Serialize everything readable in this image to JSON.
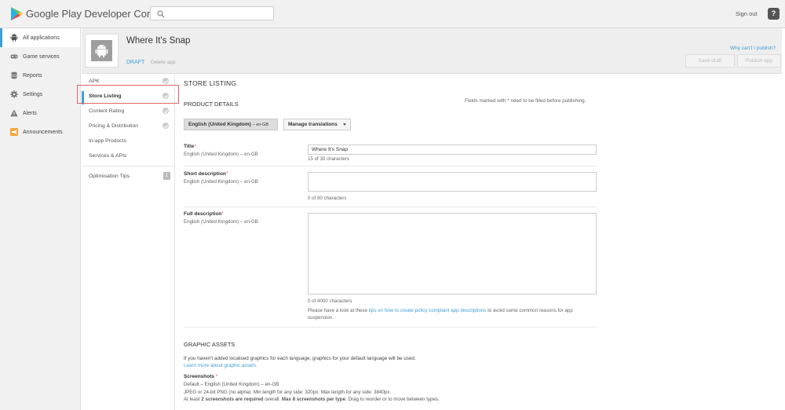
{
  "header": {
    "brand_google": "Google Play",
    "brand_console": "Developer Console",
    "search_placeholder": "",
    "sign_out": "Sign out",
    "help_glyph": "?"
  },
  "leftnav": {
    "items": [
      {
        "label": "All applications",
        "icon": "android-icon",
        "active": true
      },
      {
        "label": "Game services",
        "icon": "gamepad-icon"
      },
      {
        "label": "Reports",
        "icon": "database-icon"
      },
      {
        "label": "Settings",
        "icon": "gear-icon"
      },
      {
        "label": "Alerts",
        "icon": "warning-icon"
      },
      {
        "label": "Announcements",
        "icon": "megaphone-icon"
      }
    ]
  },
  "app": {
    "title": "Where It's Snap",
    "status": "DRAFT",
    "delete": "Delete app",
    "why_cant_publish": "Why can't I publish?",
    "save_draft": "Save draft",
    "publish": "Publish app"
  },
  "subnav": {
    "items": [
      {
        "label": "APK",
        "checked": true
      },
      {
        "label": "Store Listing",
        "checked": true,
        "selected": true
      },
      {
        "label": "Content Rating",
        "checked": true
      },
      {
        "label": "Pricing & Distribution",
        "checked": true
      },
      {
        "label": "In-app Products",
        "checked": false
      },
      {
        "label": "Services & APIs",
        "checked": false
      }
    ],
    "optimisation": {
      "label": "Optimisation Tips",
      "badge": "1"
    }
  },
  "main": {
    "store_listing": "STORE LISTING",
    "product_details": "PRODUCT DETAILS",
    "fields_note": "Fields marked with * need to be filled before publishing.",
    "language_button": "English (United Kingdom)",
    "language_code": "– en-GB",
    "manage_translations": "Manage translations",
    "title_field": {
      "label": "Title",
      "sub": "English (United Kingdom) – en-GB",
      "value": "Where It's Snap",
      "counter": "15 of 30 characters"
    },
    "short_desc": {
      "label": "Short description",
      "sub": "English (United Kingdom) – en-GB",
      "value": "",
      "counter": "0 of 80 characters"
    },
    "full_desc": {
      "label": "Full description",
      "sub": "English (United Kingdom) – en-GB",
      "value": "",
      "counter": "0 of 4000 characters"
    },
    "tips_pre": "Please have a look at these ",
    "tips_link": "tips on how to create policy compliant app descriptions",
    "tips_post": " to avoid some common reasons for app suspension.",
    "graphic_assets": "GRAPHIC ASSETS",
    "ga_line1": "If you haven't added localised graphics for each language, graphics for your default language will be used.",
    "ga_link": "Learn more about graphic assets.",
    "screenshots_label": "Screenshots",
    "ss_line1": "Default – English (United Kingdom) – en-GB",
    "ss_line2": "JPEG or 24-bit PNG (no alpha). Min length for any side: 320px. Max length for any side: 3840px.",
    "ss_line3_a": "At least ",
    "ss_line3_b": "2 screenshots are required",
    "ss_line3_c": " overall. ",
    "ss_line3_d": "Max 8 screenshots per type",
    "ss_line3_e": ". Drag to reorder or to move between types."
  },
  "colors": {
    "accent": "#3f9fd6",
    "required": "#e06666",
    "highlight_border": "#e06666"
  }
}
